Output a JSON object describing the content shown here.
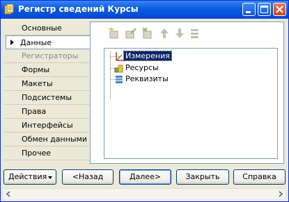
{
  "window": {
    "title": "Регистр сведений Курсы"
  },
  "sidebar": {
    "items": [
      {
        "label": "Основные"
      },
      {
        "label": "Данные"
      },
      {
        "label": "Регистраторы"
      },
      {
        "label": "Формы"
      },
      {
        "label": "Макеты"
      },
      {
        "label": "Подсистемы"
      },
      {
        "label": "Права"
      },
      {
        "label": "Интерфейсы"
      },
      {
        "label": "Обмен данными"
      },
      {
        "label": "Прочее"
      }
    ],
    "active_index": 1
  },
  "toolbar": {
    "icons": [
      "add-icon",
      "edit-icon",
      "delete-icon",
      "move-up-icon",
      "move-down-icon",
      "sort-icon"
    ]
  },
  "tree": {
    "nodes": [
      {
        "label": "Измерения",
        "icon": "dimensions-icon",
        "selected": true
      },
      {
        "label": "Ресурсы",
        "icon": "resources-icon",
        "selected": false
      },
      {
        "label": "Реквизиты",
        "icon": "attributes-icon",
        "selected": false
      }
    ]
  },
  "buttons": {
    "actions": "Действия",
    "back": "<Назад",
    "next": "Далее>",
    "close": "Закрыть",
    "help": "Справка"
  },
  "colors": {
    "titlebar": "#0a5bdf",
    "selection": "#0a246a",
    "window_bg": "#ece9d8"
  }
}
